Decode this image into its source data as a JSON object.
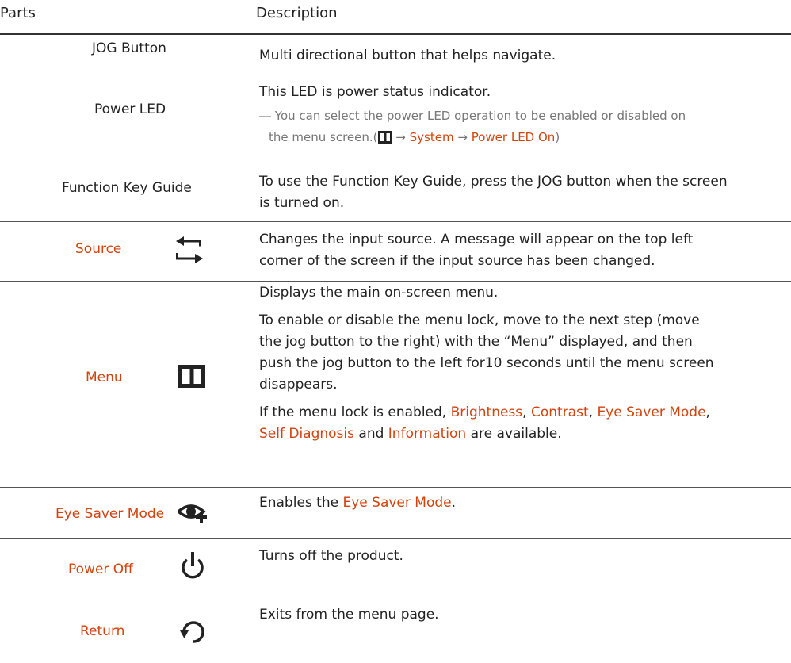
{
  "header": {
    "parts": "Parts",
    "description": "Description"
  },
  "rows": [
    {
      "part": "JOG Button",
      "desc": [
        "Multi directional button that helps navigate."
      ]
    },
    {
      "part": "Power LED",
      "desc": [
        "This LED is power status indicator."
      ],
      "note": {
        "dash": "―",
        "text1": "You can select the power LED operation to be enabled or disabled on",
        "text2": "the menu screen.(",
        "arrow1": "→",
        "link1": "System",
        "arrow2": "→",
        "link2": "Power LED On",
        "close": ")"
      }
    },
    {
      "part": "Function Key Guide",
      "desc": [
        "To use the Function Key Guide, press the JOG button when the screen",
        "is turned on."
      ]
    },
    {
      "part": "Source",
      "icon": "source-switch-icon",
      "desc": [
        "Changes the input source. A message will appear on the top left",
        "corner of the screen if the input source has been changed."
      ]
    },
    {
      "part": "Menu",
      "icon": "menu-icon",
      "desc": [
        "Displays the main on-screen menu.",
        "To enable or disable the menu lock, move to the next step (move",
        "the jog button to the right) with the “Menu” displayed, and then",
        "push the jog button to the left for10 seconds until the menu screen",
        "disappears."
      ],
      "lock": {
        "pre": "If the menu lock is enabled, ",
        "i1": "Brightness",
        "s1": ", ",
        "i2": "Contrast",
        "s2": ", ",
        "i3": "Eye Saver Mode",
        "s3": ",",
        "i4": "Self Diagnosis",
        "s4": " and ",
        "i5": "Information",
        "s5": " are available."
      }
    },
    {
      "part": "Eye Saver Mode",
      "icon": "eye-saver-icon",
      "desc_pre": "Enables the ",
      "desc_link": "Eye Saver Mode",
      "desc_post": "."
    },
    {
      "part": "Power Off",
      "icon": "power-icon",
      "desc": [
        "Turns off the product."
      ]
    },
    {
      "part": "Return",
      "icon": "return-icon",
      "desc": [
        "Exits from the menu page."
      ]
    }
  ],
  "colors": {
    "highlight": "#d2430f",
    "text": "#222222",
    "note": "#777777",
    "rule": "#555555"
  }
}
